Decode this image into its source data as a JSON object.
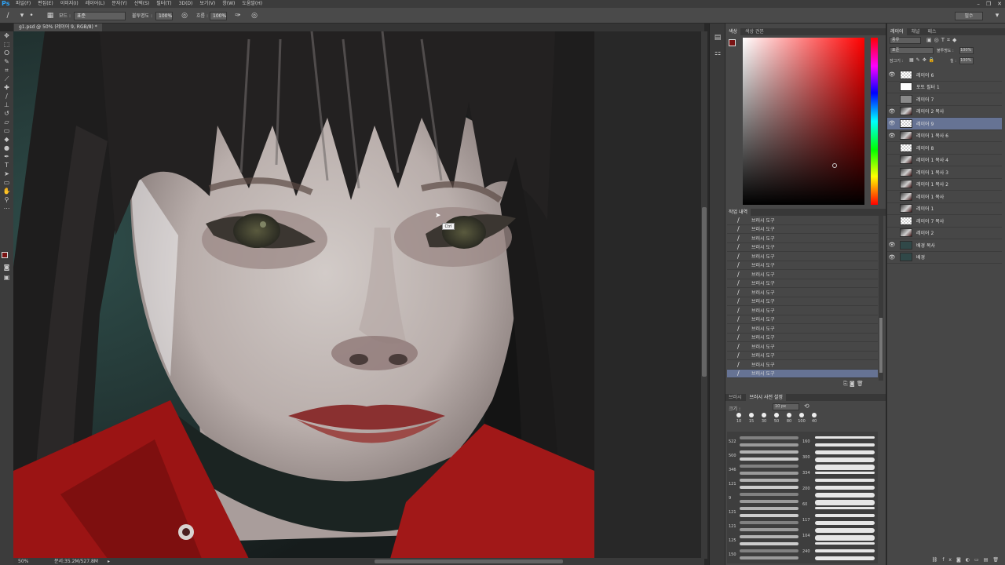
{
  "app": {
    "menu": [
      "파일(F)",
      "편집(E)",
      "이미지(I)",
      "레이어(L)",
      "문자(Y)",
      "선택(S)",
      "필터(T)",
      "3D(D)",
      "보기(V)",
      "창(W)",
      "도움말(H)"
    ],
    "workspace": "필수"
  },
  "options": {
    "mode_label": "모드 :",
    "mode_value": "표준",
    "opacity_label": "불투명도 :",
    "opacity_value": "100%",
    "flow_label": "흐름 :",
    "flow_value": "100%"
  },
  "document": {
    "tab_title": "g1.psd @ 50% (레이어 9, RGB/8) *",
    "zoom": "50%",
    "doc_size": "문서:35.2M/527.8M",
    "cursor_tooltip": "Ctrl"
  },
  "panels": {
    "color_tabs": [
      "색상",
      "색상 견본"
    ],
    "history_tab": "작업 내역",
    "history_items": [
      "브러시 도구",
      "브러시 도구",
      "브러시 도구",
      "브러시 도구",
      "브러시 도구",
      "브러시 도구",
      "브러시 도구",
      "브러시 도구",
      "브러시 도구",
      "브러시 도구",
      "브러시 도구",
      "브러시 도구",
      "브러시 도구",
      "브러시 도구",
      "브러시 도구",
      "브러시 도구",
      "브러시 도구",
      "브러시 도구"
    ],
    "brush_tabs": [
      "브러시",
      "브러시 사전 설정"
    ],
    "brush_size_label": "크기 :",
    "brush_size_value": "10 px",
    "brush_tip_sizes": [
      "10",
      "15",
      "30",
      "50",
      "80",
      "100",
      "40"
    ],
    "brush_numbers_left": [
      "522",
      "500",
      "346",
      "121",
      "9",
      "121",
      "121",
      "125",
      "150"
    ],
    "brush_numbers_right": [
      "160",
      "300",
      "334",
      "200",
      "60",
      "117",
      "104",
      "240"
    ]
  },
  "layers": {
    "tabs": [
      "레이어",
      "채널",
      "패스"
    ],
    "kind_label": "종류",
    "blend_mode": "표준",
    "opacity_label": "불투명도 :",
    "opacity_value": "100%",
    "lock_label": "잠그기 :",
    "fill_label": "칠 :",
    "fill_value": "100%",
    "items": [
      {
        "name": "레이어 6",
        "visible": true,
        "thumb": "check"
      },
      {
        "name": "포토 필터 1",
        "visible": false,
        "thumb": "white"
      },
      {
        "name": "레이어 7",
        "visible": false,
        "thumb": "gray"
      },
      {
        "name": "레이어 2 복사",
        "visible": true,
        "thumb": "face"
      },
      {
        "name": "레이어 9",
        "visible": true,
        "thumb": "check",
        "selected": true
      },
      {
        "name": "레이어 1 복사 6",
        "visible": true,
        "thumb": "face"
      },
      {
        "name": "레이어 8",
        "visible": false,
        "thumb": "check"
      },
      {
        "name": "레이어 1 복사 4",
        "visible": false,
        "thumb": "face"
      },
      {
        "name": "레이어 1 복사 3",
        "visible": false,
        "thumb": "face"
      },
      {
        "name": "레이어 1 복사 2",
        "visible": false,
        "thumb": "face"
      },
      {
        "name": "레이어 1 복사",
        "visible": false,
        "thumb": "face"
      },
      {
        "name": "레이어 1",
        "visible": false,
        "thumb": "face"
      },
      {
        "name": "레이어 7 복사",
        "visible": false,
        "thumb": "check"
      },
      {
        "name": "레이어 2",
        "visible": false,
        "thumb": "face"
      },
      {
        "name": "배경 복사",
        "visible": true,
        "thumb": "dark"
      },
      {
        "name": "배경",
        "visible": true,
        "thumb": "dark"
      }
    ]
  }
}
